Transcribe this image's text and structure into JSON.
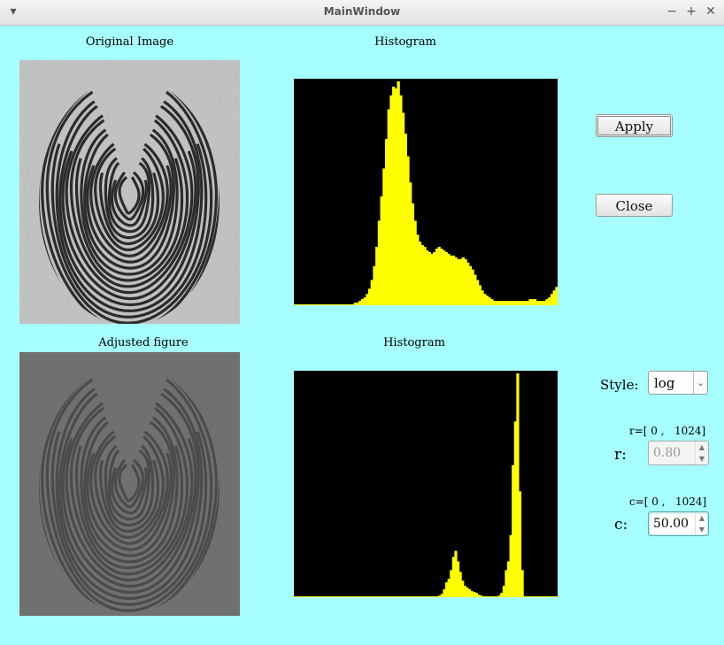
{
  "window": {
    "title": "MainWindow",
    "menu_icon": "▾",
    "minimize_icon": "−",
    "maximize_icon": "+",
    "close_icon": "✕"
  },
  "labels": {
    "original_image": "Original Image",
    "histogram_top": "Histogram",
    "adjusted_figure": "Adjusted figure",
    "histogram_bottom": "Histogram"
  },
  "buttons": {
    "apply": "Apply",
    "close": "Close"
  },
  "style": {
    "label": "Style:",
    "value": "log"
  },
  "r_param": {
    "range": "r=[ 0 ,   1024]",
    "label": "r:",
    "value": "0.80"
  },
  "c_param": {
    "range": "c=[ 0 ,   1024]",
    "label": "c:",
    "value": "50.00"
  },
  "colors": {
    "background": "#a6fefe",
    "histogram_bg": "#000000",
    "histogram_fill": "#ffff00"
  },
  "histograms": {
    "original": [
      0,
      0,
      0,
      0,
      0,
      0,
      0,
      0,
      0,
      0,
      0,
      0,
      0,
      0,
      0,
      0,
      0,
      0,
      0,
      0,
      0,
      0,
      0,
      0,
      0,
      1,
      1,
      2,
      3,
      4,
      6,
      9,
      14,
      22,
      33,
      48,
      62,
      78,
      95,
      112,
      120,
      125,
      124,
      128,
      120,
      110,
      98,
      85,
      70,
      58,
      48,
      40,
      36,
      34,
      33,
      31,
      30,
      29,
      30,
      32,
      33,
      32,
      31,
      30,
      29,
      28,
      28,
      27,
      26,
      26,
      27,
      26,
      24,
      22,
      20,
      17,
      14,
      11,
      8,
      6,
      5,
      4,
      3,
      2,
      2,
      2,
      2,
      2,
      2,
      2,
      2,
      2,
      2,
      2,
      2,
      2,
      2,
      2,
      3,
      3,
      3,
      2,
      2,
      2,
      2,
      3,
      4,
      6,
      8,
      10
    ],
    "adjusted": [
      0,
      0,
      0,
      0,
      0,
      0,
      0,
      0,
      0,
      0,
      0,
      0,
      0,
      0,
      0,
      0,
      0,
      0,
      0,
      0,
      0,
      0,
      0,
      0,
      0,
      0,
      0,
      0,
      0,
      0,
      0,
      0,
      0,
      0,
      0,
      0,
      0,
      0,
      0,
      0,
      0,
      0,
      0,
      0,
      0,
      0,
      0,
      0,
      0,
      0,
      0,
      0,
      0,
      0,
      0,
      0,
      0,
      0,
      0,
      0,
      0,
      0,
      0,
      1,
      3,
      8,
      16,
      20,
      30,
      45,
      52,
      40,
      28,
      18,
      12,
      10,
      8,
      6,
      5,
      4,
      2,
      1,
      0,
      0,
      0,
      0,
      0,
      0,
      0,
      1,
      4,
      12,
      30,
      40,
      70,
      150,
      200,
      255,
      120,
      30,
      0,
      0,
      0,
      0,
      0,
      0,
      0,
      0,
      0,
      0,
      0,
      0,
      0,
      0,
      0
    ]
  }
}
